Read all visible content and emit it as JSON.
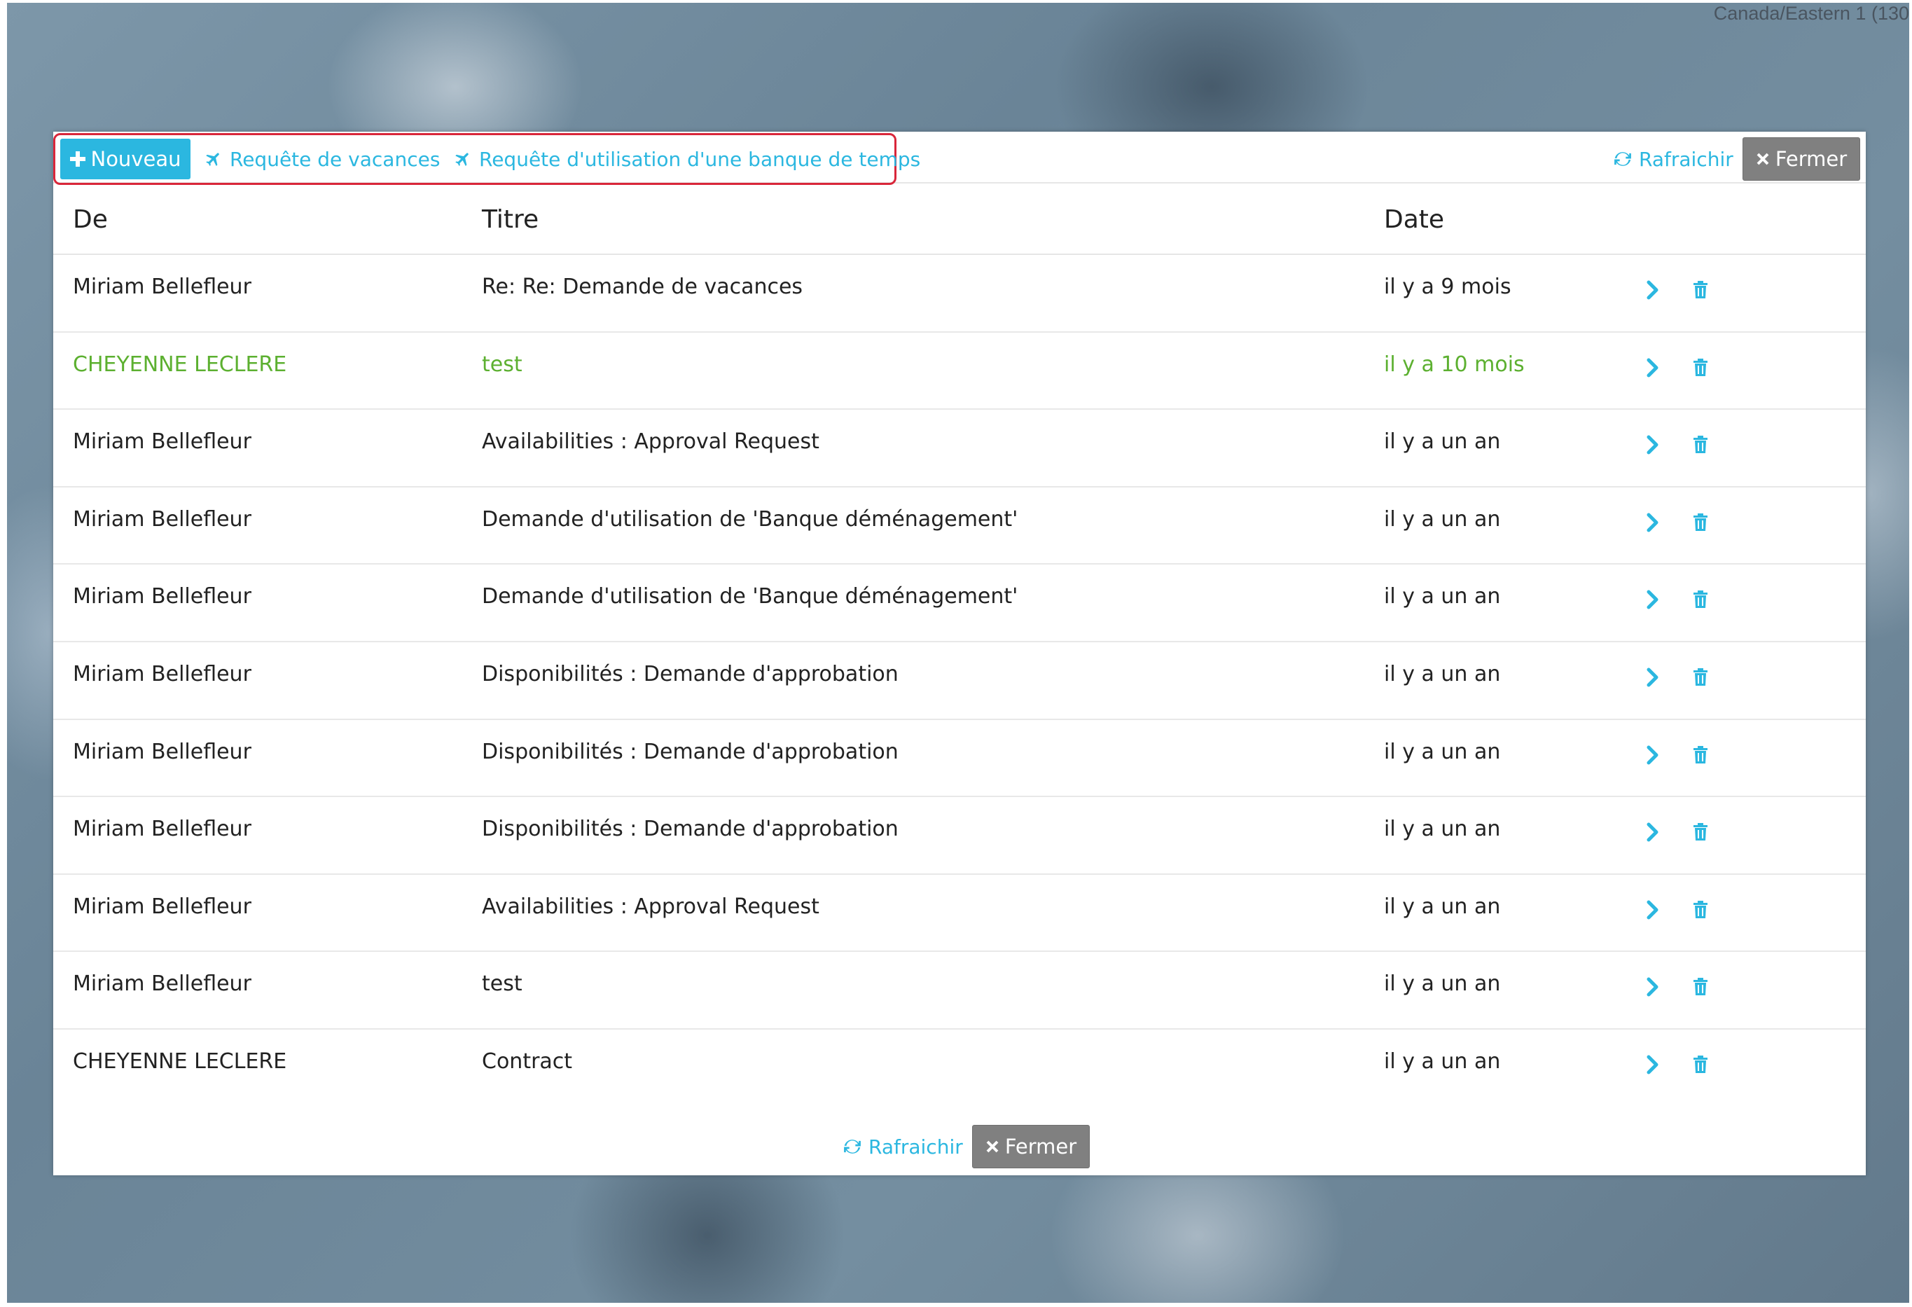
{
  "timezone": "Canada/Eastern 1 (130",
  "toolbar": {
    "new_label": "Nouveau",
    "vacation_request_label": "Requête de vacances",
    "time_bank_request_label": "Requête d'utilisation d'une banque de temps",
    "refresh_label": "Rafraichir",
    "close_label": "Fermer"
  },
  "table": {
    "headers": {
      "from": "De",
      "title": "Titre",
      "date": "Date"
    },
    "rows": [
      {
        "from": "Miriam Bellefleur",
        "title": "Re: Re: Demande de vacances",
        "date": "il y a 9 mois",
        "unread": false
      },
      {
        "from": "CHEYENNE LECLERE",
        "title": "test",
        "date": "il y a 10 mois",
        "unread": true
      },
      {
        "from": "Miriam Bellefleur",
        "title": "Availabilities : Approval Request",
        "date": "il y a un an",
        "unread": false
      },
      {
        "from": "Miriam Bellefleur",
        "title": "Demande d'utilisation de 'Banque déménagement'",
        "date": "il y a un an",
        "unread": false
      },
      {
        "from": "Miriam Bellefleur",
        "title": "Demande d'utilisation de 'Banque déménagement'",
        "date": "il y a un an",
        "unread": false
      },
      {
        "from": "Miriam Bellefleur",
        "title": "Disponibilités : Demande d'approbation",
        "date": "il y a un an",
        "unread": false
      },
      {
        "from": "Miriam Bellefleur",
        "title": "Disponibilités : Demande d'approbation",
        "date": "il y a un an",
        "unread": false
      },
      {
        "from": "Miriam Bellefleur",
        "title": "Disponibilités : Demande d'approbation",
        "date": "il y a un an",
        "unread": false
      },
      {
        "from": "Miriam Bellefleur",
        "title": "Availabilities : Approval Request",
        "date": "il y a un an",
        "unread": false
      },
      {
        "from": "Miriam Bellefleur",
        "title": "test",
        "date": "il y a un an",
        "unread": false
      },
      {
        "from": "CHEYENNE LECLERE",
        "title": "Contract",
        "date": "il y a un an",
        "unread": false
      }
    ]
  },
  "footer": {
    "refresh_label": "Rafraichir",
    "close_label": "Fermer"
  },
  "colors": {
    "accent": "#2bb7e0",
    "unread": "#5cb030",
    "close_button": "#808080",
    "highlight": "#d9263a"
  }
}
